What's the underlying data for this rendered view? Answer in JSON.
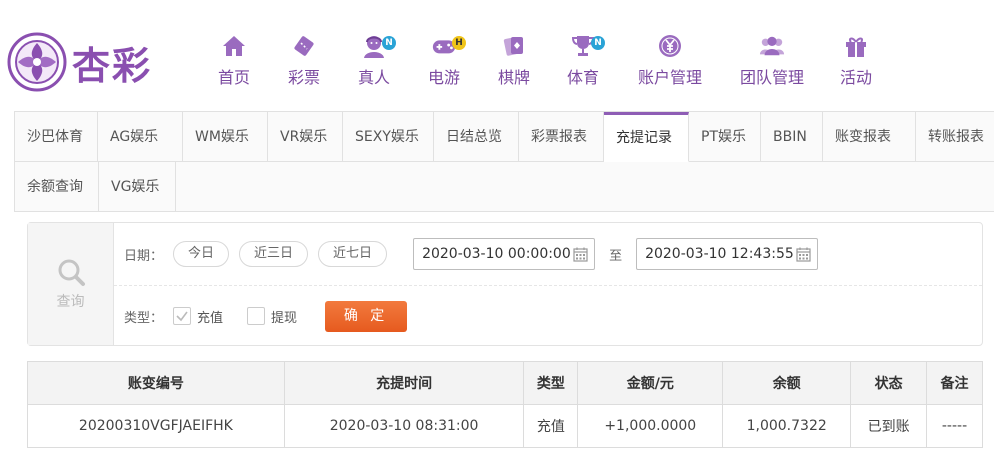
{
  "brand": {
    "name": "杏彩"
  },
  "nav": [
    {
      "label": "首页",
      "icon": "home-icon",
      "badge": ""
    },
    {
      "label": "彩票",
      "icon": "lottery-ticket-icon",
      "badge": ""
    },
    {
      "label": "真人",
      "icon": "live-dealer-icon",
      "badge": "N"
    },
    {
      "label": "电游",
      "icon": "gamepad-icon",
      "badge": "H"
    },
    {
      "label": "棋牌",
      "icon": "cards-icon",
      "badge": ""
    },
    {
      "label": "体育",
      "icon": "trophy-icon",
      "badge": "N"
    },
    {
      "label": "账户管理",
      "icon": "yen-coin-icon",
      "badge": ""
    },
    {
      "label": "团队管理",
      "icon": "team-icon",
      "badge": ""
    },
    {
      "label": "活动",
      "icon": "gift-icon",
      "badge": ""
    }
  ],
  "tabs_row1": [
    "沙巴体育",
    "AG娱乐",
    "WM娱乐",
    "VR娱乐",
    "SEXY娱乐",
    "日结总览",
    "彩票报表",
    "充提记录",
    "PT娱乐",
    "BBIN",
    "账变报表",
    "转账报表"
  ],
  "tabs_row2": [
    "余额查询",
    "VG娱乐"
  ],
  "active_tab": "充提记录",
  "query": {
    "side_label": "查询",
    "date_label": "日期：",
    "quick_ranges": [
      "今日",
      "近三日",
      "近七日"
    ],
    "start": "2020-03-10 00:00:00",
    "to_label": "至",
    "end": "2020-03-10 12:43:55",
    "type_label": "类型：",
    "types": [
      {
        "label": "充值",
        "checked": true
      },
      {
        "label": "提现",
        "checked": false
      }
    ],
    "confirm": "确 定"
  },
  "table": {
    "headers": [
      "账变编号",
      "充提时间",
      "类型",
      "金额/元",
      "余额",
      "状态",
      "备注"
    ],
    "rows": [
      [
        "20200310VGFJAEIFHK",
        "2020-03-10 08:31:00",
        "充值",
        "+1,000.0000",
        "1,000.7322",
        "已到账",
        "-----"
      ]
    ]
  },
  "colors": {
    "brand_purple": "#8a4fb0",
    "active_tab_border": "#8e5db5",
    "confirm_orange": "#e65a1f",
    "amount_red": "#d2252a",
    "status_green": "#2aa32a"
  }
}
